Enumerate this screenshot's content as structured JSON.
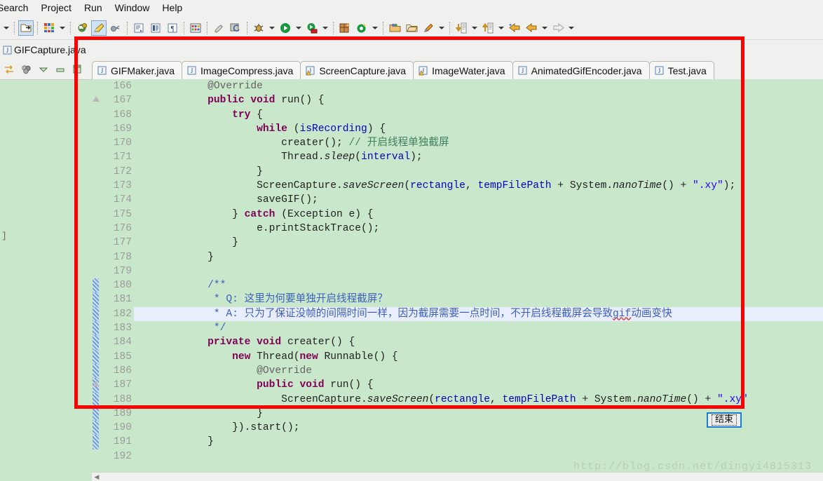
{
  "menu": {
    "items": [
      {
        "label": "Search"
      },
      {
        "label": "Project"
      },
      {
        "label": "Run"
      },
      {
        "label": "Window"
      },
      {
        "label": "Help"
      }
    ]
  },
  "toolbar": {
    "groups": [
      {
        "items": [
          {
            "name": "toolbar-dropdown-arrow-0",
            "kind": "arrow"
          },
          {
            "name": "new-wizard-icon",
            "kind": "icon",
            "selected": true
          },
          {
            "name": "new-java-class-icon",
            "kind": "icon"
          },
          {
            "name": "toolbar-dropdown-arrow-1",
            "kind": "arrow"
          }
        ]
      },
      {
        "items": [
          {
            "name": "save-icon",
            "kind": "icon"
          },
          {
            "name": "highlight-pencil-icon",
            "kind": "icon",
            "selected": true
          },
          {
            "name": "link-editor-icon",
            "kind": "icon"
          },
          {
            "name": "print-icon",
            "kind": "icon"
          },
          {
            "name": "outline-icon",
            "kind": "icon"
          },
          {
            "name": "paragraph-marks-icon",
            "kind": "icon"
          }
        ]
      },
      {
        "items": [
          {
            "name": "open-perspective-icon",
            "kind": "icon"
          }
        ]
      },
      {
        "items": [
          {
            "name": "build-icon",
            "kind": "icon"
          },
          {
            "name": "refresh-project-icon",
            "kind": "icon"
          }
        ]
      },
      {
        "items": [
          {
            "name": "debug-icon",
            "kind": "icon"
          },
          {
            "name": "debug-dropdown-arrow",
            "kind": "arrow"
          },
          {
            "name": "run-icon",
            "kind": "icon"
          },
          {
            "name": "run-dropdown-arrow",
            "kind": "arrow"
          },
          {
            "name": "run-external-tools-icon",
            "kind": "icon"
          },
          {
            "name": "external-tools-dropdown-arrow",
            "kind": "arrow"
          }
        ]
      },
      {
        "items": [
          {
            "name": "new-package-icon",
            "kind": "icon"
          },
          {
            "name": "new-annotation-icon",
            "kind": "icon"
          },
          {
            "name": "new-annotation-dropdown-arrow",
            "kind": "arrow"
          }
        ]
      },
      {
        "items": [
          {
            "name": "open-type-icon",
            "kind": "icon"
          },
          {
            "name": "open-task-icon",
            "kind": "icon"
          },
          {
            "name": "search-icon",
            "kind": "icon"
          },
          {
            "name": "search-dropdown-arrow",
            "kind": "arrow"
          }
        ]
      },
      {
        "items": [
          {
            "name": "next-annotation-icon",
            "kind": "icon"
          },
          {
            "name": "next-annotation-dropdown-arrow",
            "kind": "arrow"
          },
          {
            "name": "previous-annotation-icon",
            "kind": "icon"
          },
          {
            "name": "previous-annotation-dropdown-arrow",
            "kind": "arrow"
          },
          {
            "name": "last-edit-location-icon",
            "kind": "icon"
          },
          {
            "name": "back-icon",
            "kind": "icon"
          },
          {
            "name": "back-dropdown-arrow",
            "kind": "arrow"
          },
          {
            "name": "forward-icon",
            "kind": "icon"
          },
          {
            "name": "forward-dropdown-arrow",
            "kind": "arrow"
          }
        ]
      }
    ]
  },
  "left_panel": {
    "title": "GIFCapture.java",
    "toolbar": [
      {
        "name": "link-with-editor-icon"
      },
      {
        "name": "collapse-all-icon"
      },
      {
        "name": "view-menu-icon"
      },
      {
        "name": "minimize-icon"
      },
      {
        "name": "maximize-icon"
      }
    ],
    "stub_text": "]"
  },
  "tabs": [
    {
      "label": "GIFMaker.java",
      "icon": "java-file-icon",
      "warning": false
    },
    {
      "label": "ImageCompress.java",
      "icon": "java-file-icon",
      "warning": false
    },
    {
      "label": "ScreenCapture.java",
      "icon": "java-file-warning-icon",
      "warning": true
    },
    {
      "label": "ImageWater.java",
      "icon": "java-file-warning-icon",
      "warning": true
    },
    {
      "label": "AnimatedGifEncoder.java",
      "icon": "java-file-icon",
      "warning": false
    },
    {
      "label": "Test.java",
      "icon": "java-file-icon",
      "warning": false
    }
  ],
  "editor": {
    "first_line": 166,
    "highlighted_line": 182,
    "lines": [
      {
        "n": "166",
        "fold": "collapse",
        "warn": false,
        "change": "none",
        "segs": [
          {
            "t": "            ",
            "c": "plain"
          },
          {
            "t": "@Override",
            "c": "ann2"
          }
        ]
      },
      {
        "n": "167",
        "fold": "none",
        "warn": true,
        "change": "none",
        "segs": [
          {
            "t": "            ",
            "c": "plain"
          },
          {
            "t": "public void ",
            "c": "kw"
          },
          {
            "t": "run() {",
            "c": "plain"
          }
        ]
      },
      {
        "n": "168",
        "fold": "none",
        "warn": false,
        "change": "none",
        "segs": [
          {
            "t": "                ",
            "c": "plain"
          },
          {
            "t": "try",
            "c": "kw"
          },
          {
            "t": " {",
            "c": "plain"
          }
        ]
      },
      {
        "n": "169",
        "fold": "none",
        "warn": false,
        "change": "none",
        "segs": [
          {
            "t": "                    ",
            "c": "plain"
          },
          {
            "t": "while",
            "c": "kw"
          },
          {
            "t": " (",
            "c": "plain"
          },
          {
            "t": "isRecording",
            "c": "fld"
          },
          {
            "t": ") {",
            "c": "plain"
          }
        ]
      },
      {
        "n": "170",
        "fold": "none",
        "warn": false,
        "change": "none",
        "segs": [
          {
            "t": "                        creater(); ",
            "c": "plain"
          },
          {
            "t": "// 开启线程单独截屏",
            "c": "cmt"
          }
        ]
      },
      {
        "n": "171",
        "fold": "none",
        "warn": false,
        "change": "none",
        "segs": [
          {
            "t": "                        Thread.",
            "c": "plain"
          },
          {
            "t": "sleep",
            "c": "ital"
          },
          {
            "t": "(",
            "c": "plain"
          },
          {
            "t": "interval",
            "c": "fld"
          },
          {
            "t": ");",
            "c": "plain"
          }
        ]
      },
      {
        "n": "172",
        "fold": "none",
        "warn": false,
        "change": "none",
        "segs": [
          {
            "t": "                    }",
            "c": "plain"
          }
        ]
      },
      {
        "n": "173",
        "fold": "none",
        "warn": false,
        "change": "none",
        "segs": [
          {
            "t": "                    ScreenCapture.",
            "c": "plain"
          },
          {
            "t": "saveScreen",
            "c": "ital"
          },
          {
            "t": "(",
            "c": "plain"
          },
          {
            "t": "rectangle",
            "c": "fld"
          },
          {
            "t": ", ",
            "c": "plain"
          },
          {
            "t": "tempFilePath",
            "c": "fld"
          },
          {
            "t": " + System.",
            "c": "plain"
          },
          {
            "t": "nanoTime",
            "c": "ital"
          },
          {
            "t": "() + ",
            "c": "plain"
          },
          {
            "t": "\".xy\"",
            "c": "str"
          },
          {
            "t": ");",
            "c": "plain"
          }
        ]
      },
      {
        "n": "174",
        "fold": "none",
        "warn": false,
        "change": "none",
        "segs": [
          {
            "t": "                    saveGIF();",
            "c": "plain"
          }
        ]
      },
      {
        "n": "175",
        "fold": "none",
        "warn": false,
        "change": "none",
        "segs": [
          {
            "t": "                } ",
            "c": "plain"
          },
          {
            "t": "catch",
            "c": "kw"
          },
          {
            "t": " (Exception e) {",
            "c": "plain"
          }
        ]
      },
      {
        "n": "176",
        "fold": "none",
        "warn": false,
        "change": "none",
        "segs": [
          {
            "t": "                    e.printStackTrace();",
            "c": "plain"
          }
        ]
      },
      {
        "n": "177",
        "fold": "none",
        "warn": false,
        "change": "none",
        "segs": [
          {
            "t": "                }",
            "c": "plain"
          }
        ]
      },
      {
        "n": "178",
        "fold": "none",
        "warn": false,
        "change": "none",
        "segs": [
          {
            "t": "            }",
            "c": "plain"
          }
        ]
      },
      {
        "n": "179",
        "fold": "none",
        "warn": false,
        "change": "none",
        "segs": [
          {
            "t": "",
            "c": "plain"
          }
        ]
      },
      {
        "n": "180",
        "fold": "collapse",
        "warn": false,
        "change": "hatch",
        "segs": [
          {
            "t": "            ",
            "c": "plain"
          },
          {
            "t": "/**",
            "c": "jdoc"
          }
        ]
      },
      {
        "n": "181",
        "fold": "none",
        "warn": false,
        "change": "hatch",
        "segs": [
          {
            "t": "             ",
            "c": "plain"
          },
          {
            "t": "* Q: 这里为何要单独开启线程截屏？",
            "c": "jdoc"
          }
        ]
      },
      {
        "n": "182",
        "fold": "none",
        "warn": false,
        "change": "hatch",
        "segs": [
          {
            "t": "             ",
            "c": "plain"
          },
          {
            "t": "* A: 只为了保证没帧的间隔时间一样，因为截屏需要一点时间，不开启线程截屏会导致",
            "c": "jdoc"
          },
          {
            "t": "gif",
            "c": "jdoc squig"
          },
          {
            "t": "动画变快",
            "c": "jdoc"
          }
        ]
      },
      {
        "n": "183",
        "fold": "none",
        "warn": false,
        "change": "hatch",
        "segs": [
          {
            "t": "             ",
            "c": "plain"
          },
          {
            "t": "*/",
            "c": "jdoc"
          }
        ]
      },
      {
        "n": "184",
        "fold": "collapse",
        "warn": false,
        "change": "hatch",
        "segs": [
          {
            "t": "            ",
            "c": "plain"
          },
          {
            "t": "private void ",
            "c": "kw"
          },
          {
            "t": "creater() {",
            "c": "plain"
          }
        ]
      },
      {
        "n": "185",
        "fold": "collapse",
        "warn": false,
        "change": "hatch",
        "segs": [
          {
            "t": "                ",
            "c": "plain"
          },
          {
            "t": "new",
            "c": "kw"
          },
          {
            "t": " Thread(",
            "c": "plain"
          },
          {
            "t": "new",
            "c": "kw"
          },
          {
            "t": " Runnable() {",
            "c": "plain"
          }
        ]
      },
      {
        "n": "186",
        "fold": "collapse",
        "warn": false,
        "change": "hatch",
        "segs": [
          {
            "t": "                    ",
            "c": "plain"
          },
          {
            "t": "@Override",
            "c": "ann2"
          }
        ]
      },
      {
        "n": "187",
        "fold": "none",
        "warn": true,
        "change": "hatch",
        "segs": [
          {
            "t": "                    ",
            "c": "plain"
          },
          {
            "t": "public void ",
            "c": "kw"
          },
          {
            "t": "run() {",
            "c": "plain"
          }
        ]
      },
      {
        "n": "188",
        "fold": "none",
        "warn": false,
        "change": "hatch",
        "segs": [
          {
            "t": "                        ScreenCapture.",
            "c": "plain"
          },
          {
            "t": "saveScreen",
            "c": "ital"
          },
          {
            "t": "(",
            "c": "plain"
          },
          {
            "t": "rectangle",
            "c": "fld"
          },
          {
            "t": ", ",
            "c": "plain"
          },
          {
            "t": "tempFilePath",
            "c": "fld"
          },
          {
            "t": " + System.",
            "c": "plain"
          },
          {
            "t": "nanoTime",
            "c": "ital"
          },
          {
            "t": "() + ",
            "c": "plain"
          },
          {
            "t": "\".xy\"",
            "c": "str"
          }
        ]
      },
      {
        "n": "189",
        "fold": "none",
        "warn": false,
        "change": "hatch",
        "segs": [
          {
            "t": "                    }",
            "c": "plain"
          }
        ]
      },
      {
        "n": "190",
        "fold": "none",
        "warn": false,
        "change": "hatch",
        "segs": [
          {
            "t": "                }).start();",
            "c": "plain"
          }
        ]
      },
      {
        "n": "191",
        "fold": "none",
        "warn": false,
        "change": "hatch",
        "segs": [
          {
            "t": "            }",
            "c": "plain"
          }
        ]
      },
      {
        "n": "192",
        "fold": "none",
        "warn": false,
        "change": "none",
        "segs": [
          {
            "t": "",
            "c": "plain"
          }
        ]
      }
    ]
  },
  "overlay": {
    "end_button_label": "结束",
    "annotation_box_color": "#fb0000"
  },
  "watermark": "http://blog.csdn.net/dingyi4815313"
}
